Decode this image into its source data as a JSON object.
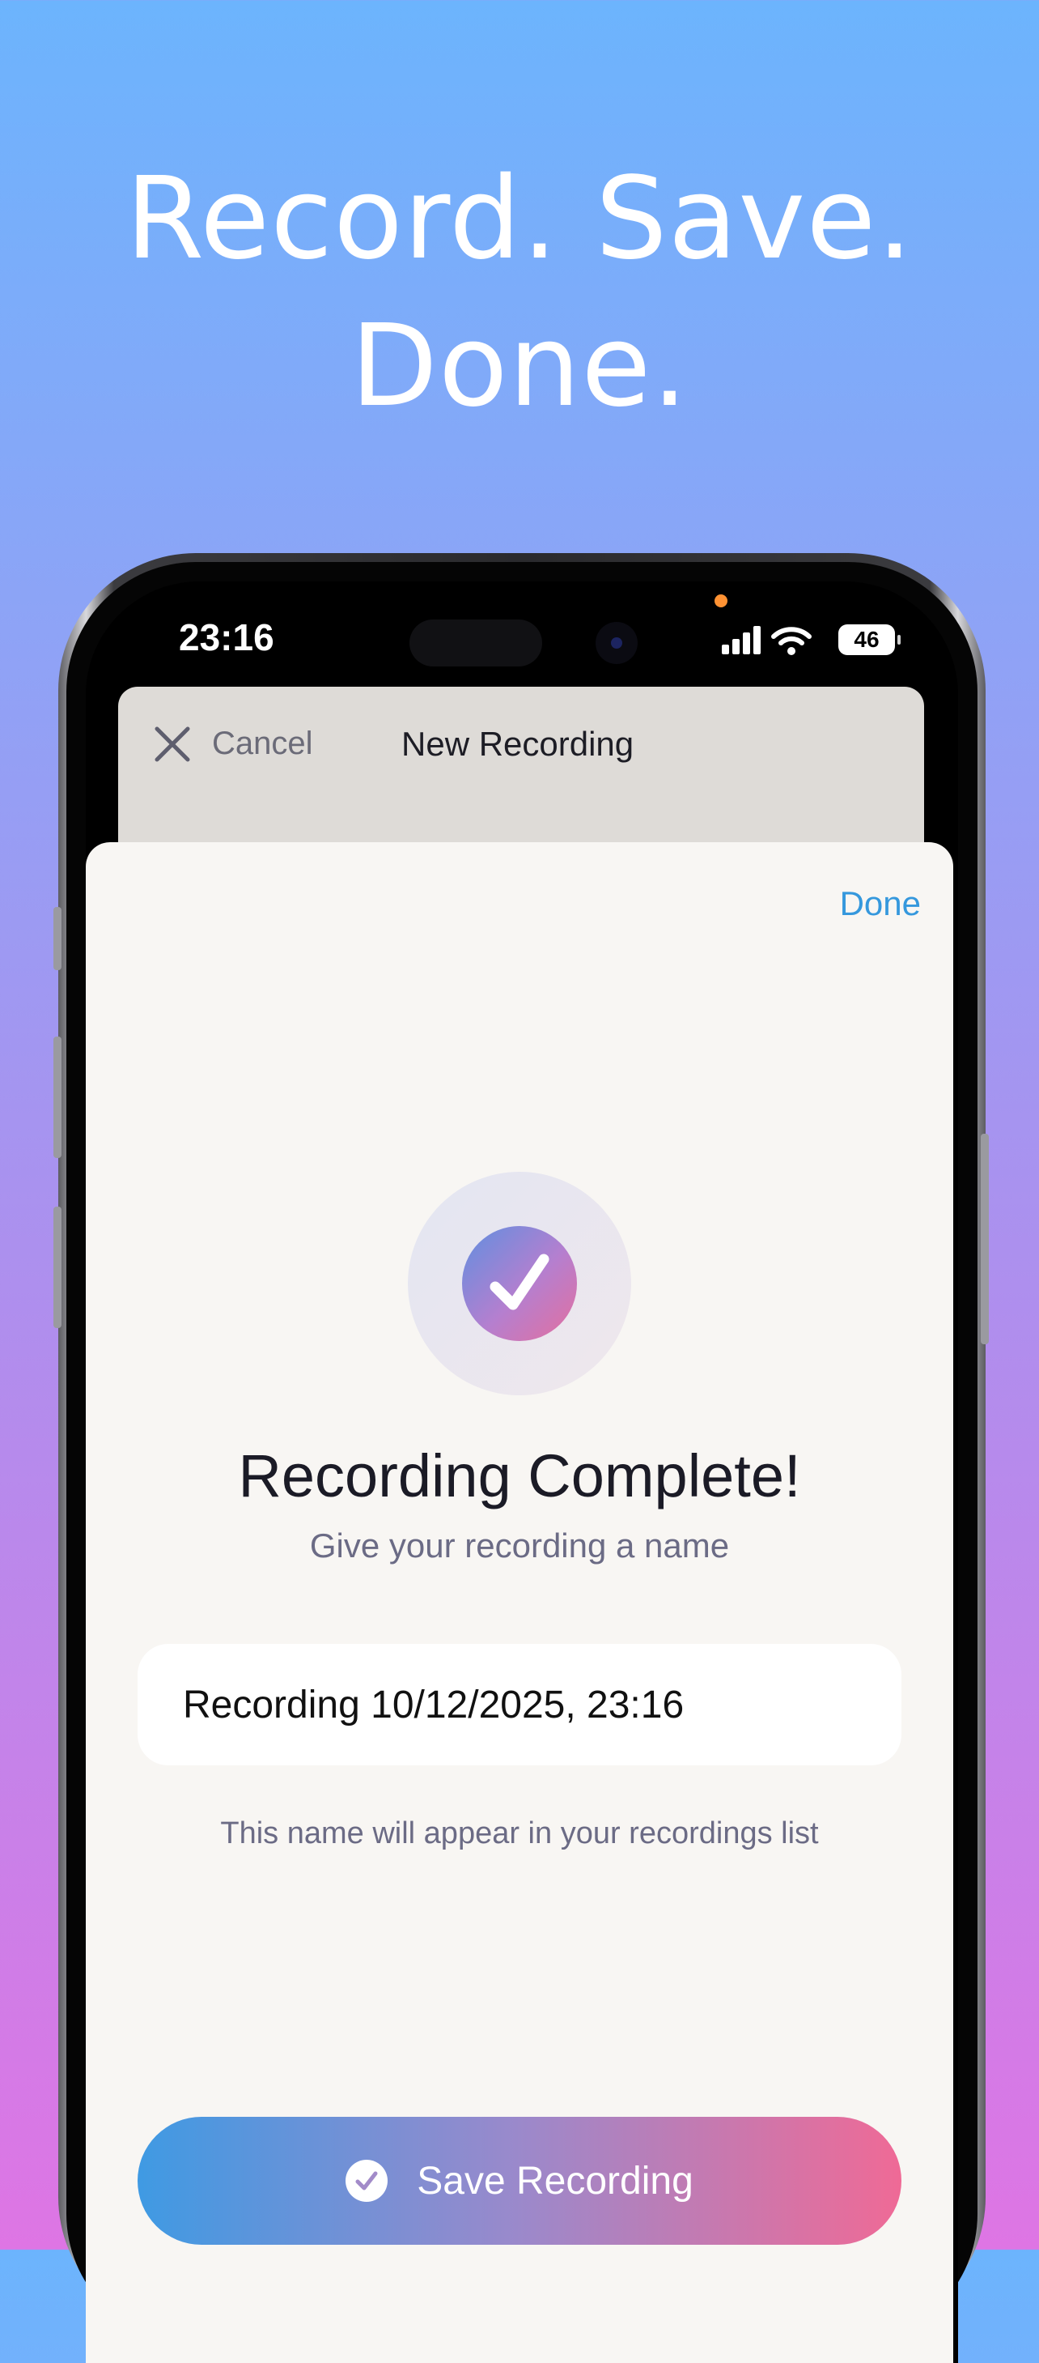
{
  "headline": {
    "line1": "Record. Save.",
    "line2": "Done."
  },
  "status_bar": {
    "time": "23:16",
    "battery": "46"
  },
  "back_sheet": {
    "cancel_label": "Cancel",
    "title": "New Recording"
  },
  "sheet": {
    "done_label": "Done",
    "title": "Recording Complete!",
    "subtitle": "Give your recording a name",
    "name_value": "Recording 10/12/2025, 23:16",
    "helper": "This name will appear in your recordings list",
    "save_label": "Save Recording"
  },
  "colors": {
    "accent_blue": "#3598dd",
    "gradient_start": "#3f9ae3",
    "gradient_end": "#ef6a96",
    "sheet_bg": "#f8f6f3"
  },
  "icons": [
    "close-icon",
    "signal-icon",
    "wifi-icon",
    "battery-icon",
    "checkmark-icon",
    "check-circle-icon"
  ]
}
